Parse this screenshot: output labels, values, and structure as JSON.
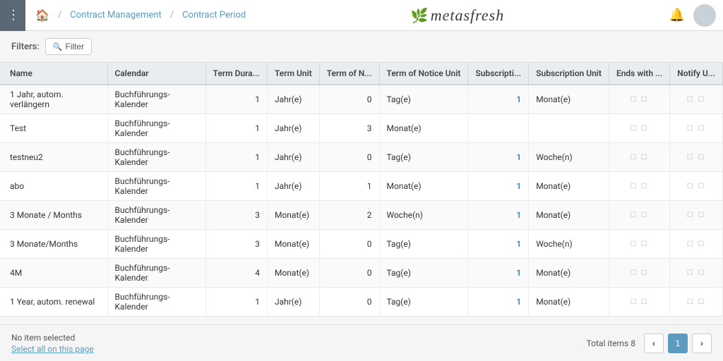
{
  "topbar": {
    "menu_icon": "⋮",
    "home_icon": "⌂",
    "breadcrumb1": "Contract Management",
    "breadcrumb2": "Contract Period",
    "logo_text": "metasfresh",
    "bell_icon": "🔔",
    "avatar_icon": ""
  },
  "filters": {
    "label": "Filters:",
    "filter_btn": "Filter"
  },
  "table": {
    "columns": [
      "Name",
      "Calendar",
      "Term Dura...",
      "Term Unit",
      "Term of N...",
      "Term of Notice Unit",
      "Subscripti...",
      "Subscription Unit",
      "Ends with ...",
      "Notify U..."
    ],
    "rows": [
      {
        "name": "1 Jahr, autom. verlängern",
        "calendar": "Buchführungs-Kalender",
        "term_duration": "1",
        "term_unit": "Jahr(e)",
        "term_of_notice": "0",
        "term_of_notice_unit": "Tag(e)",
        "subscription": "1",
        "subscription_unit": "Monat(e)",
        "ends_with": "",
        "notify_u": ""
      },
      {
        "name": "Test",
        "calendar": "Buchführungs-Kalender",
        "term_duration": "1",
        "term_unit": "Jahr(e)",
        "term_of_notice": "3",
        "term_of_notice_unit": "Monat(e)",
        "subscription": "",
        "subscription_unit": "",
        "ends_with": "",
        "notify_u": ""
      },
      {
        "name": "testneu2",
        "calendar": "Buchführungs-Kalender",
        "term_duration": "1",
        "term_unit": "Jahr(e)",
        "term_of_notice": "0",
        "term_of_notice_unit": "Tag(e)",
        "subscription": "1",
        "subscription_unit": "Woche(n)",
        "ends_with": "",
        "notify_u": ""
      },
      {
        "name": "abo",
        "calendar": "Buchführungs-Kalender",
        "term_duration": "1",
        "term_unit": "Jahr(e)",
        "term_of_notice": "1",
        "term_of_notice_unit": "Monat(e)",
        "subscription": "1",
        "subscription_unit": "Monat(e)",
        "ends_with": "",
        "notify_u": ""
      },
      {
        "name": "3 Monate / Months",
        "calendar": "Buchführungs-Kalender",
        "term_duration": "3",
        "term_unit": "Monat(e)",
        "term_of_notice": "2",
        "term_of_notice_unit": "Woche(n)",
        "subscription": "1",
        "subscription_unit": "Monat(e)",
        "ends_with": "",
        "notify_u": ""
      },
      {
        "name": "3 Monate/Months",
        "calendar": "Buchführungs-Kalender",
        "term_duration": "3",
        "term_unit": "Monat(e)",
        "term_of_notice": "0",
        "term_of_notice_unit": "Tag(e)",
        "subscription": "1",
        "subscription_unit": "Woche(n)",
        "ends_with": "",
        "notify_u": ""
      },
      {
        "name": "4M",
        "calendar": "Buchführungs-Kalender",
        "term_duration": "4",
        "term_unit": "Monat(e)",
        "term_of_notice": "0",
        "term_of_notice_unit": "Tag(e)",
        "subscription": "1",
        "subscription_unit": "Monat(e)",
        "ends_with": "",
        "notify_u": ""
      },
      {
        "name": "1 Year, autom. renewal",
        "calendar": "Buchführungs-Kalender",
        "term_duration": "1",
        "term_unit": "Jahr(e)",
        "term_of_notice": "0",
        "term_of_notice_unit": "Tag(e)",
        "subscription": "1",
        "subscription_unit": "Monat(e)",
        "ends_with": "",
        "notify_u": ""
      }
    ]
  },
  "bottom": {
    "no_item": "No item selected",
    "select_all": "Select all on this page",
    "total_label": "Total items 8",
    "page_prev": "‹",
    "page_current": "1",
    "page_next": "›"
  }
}
